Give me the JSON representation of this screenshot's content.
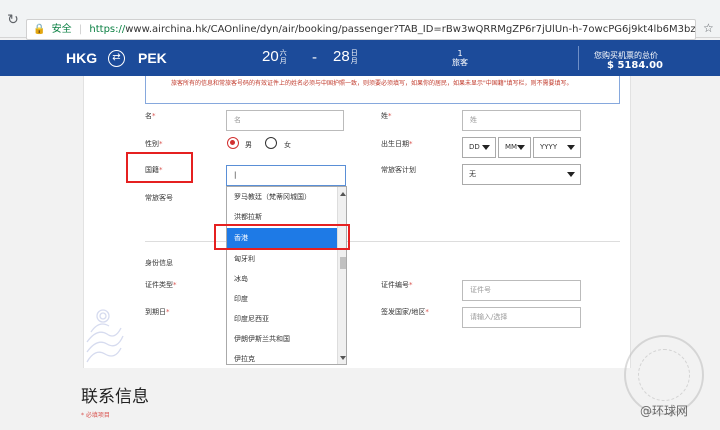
{
  "browser": {
    "secure_label": "安全",
    "url_scheme": "https://",
    "url_rest": "www.airchina.hk/CAOnline/dyn/air/booking/passenger?TAB_ID=rBw3wQRRMgZP6r7jUlUn-h-7owcPG6j9kt4lb6M3bzWFDt6C-f91l1706761992l-324216..."
  },
  "flight": {
    "origin": "HKG",
    "destination": "PEK",
    "depart_day": "20",
    "depart_month_top": "六",
    "depart_month_bottom": "月",
    "return_day": "28",
    "return_month_top": "日",
    "return_month_bottom": "月",
    "dash": "-",
    "passengers_count": "1",
    "passengers_label": "旅客",
    "price_label": "您购买机票的总价",
    "price_value": "$ 5184.00",
    "accent_color": "#1c4b9a"
  },
  "notice": {
    "text": "旅客所有的信息和常旅客号码的有效证件上的姓名必须与中国护照一致，则须要必须填写，如果你的居民，如果未显示\"中国籍\"填写栏，则不需要填写。"
  },
  "form": {
    "given_name_label": "名",
    "given_name_placeholder": "名",
    "surname_label": "姓",
    "surname_placeholder": "姓",
    "gender_label": "性别",
    "gender_male": "男",
    "gender_female": "女",
    "dob_label": "出生日期",
    "dob_day": "DD",
    "dob_month": "MM",
    "dob_year": "YYYY",
    "nationality_label": "国籍",
    "nationality_value": "|",
    "ffp_plan_label": "常旅客计划",
    "ffp_plan_value": "无",
    "ffp_number_label": "常旅客号",
    "id_section_label": "身份信息",
    "id_type_label": "证件类型",
    "id_number_label": "证件编号",
    "id_number_placeholder": "证件号",
    "expiry_label": "到期日",
    "issuing_country_label": "签发国家/地区",
    "issuing_country_placeholder": "请输入/选择",
    "required_mark": "*"
  },
  "dropdown": {
    "items": [
      "罗马教廷（梵蒂冈城国）",
      "洪都拉斯",
      "香港",
      "匈牙利",
      "冰岛",
      "印度",
      "印度尼西亚",
      "伊朗伊斯兰共和国",
      "伊拉克"
    ],
    "selected_index": 2
  },
  "contact": {
    "title": "联系信息",
    "required_note": "* 必填项目"
  },
  "watermark": {
    "text": "@环球网"
  }
}
